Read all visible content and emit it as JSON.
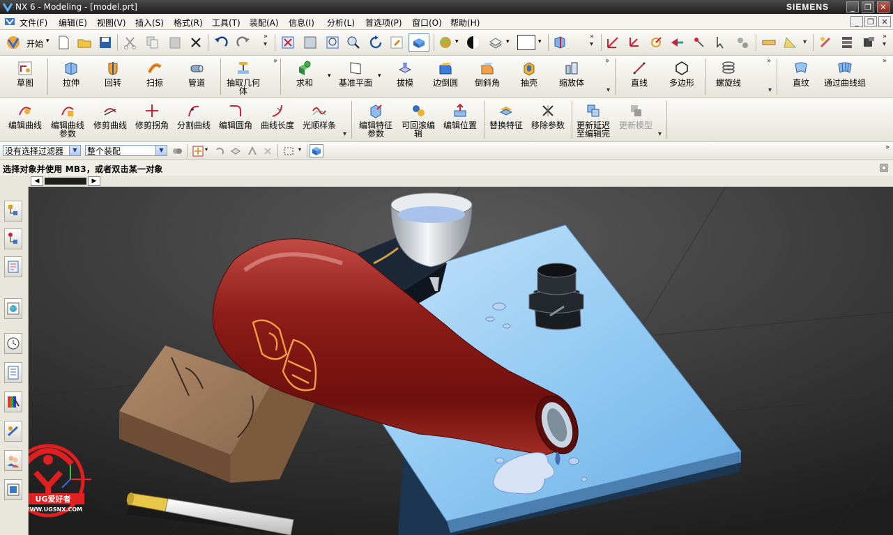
{
  "window": {
    "title": "NX 6 - Modeling - [model.prt]",
    "brand": "SIEMENS"
  },
  "menu": {
    "items": [
      "文件(F)",
      "编辑(E)",
      "视图(V)",
      "插入(S)",
      "格式(R)",
      "工具(T)",
      "装配(A)",
      "信息(I)",
      "分析(L)",
      "首选项(P)",
      "窗口(O)",
      "帮助(H)"
    ]
  },
  "toolbar1": {
    "start_label": "开始"
  },
  "toolbar2": {
    "items": [
      "草图",
      "拉伸",
      "回转",
      "扫掠",
      "管道",
      "抽取几何体",
      "求和",
      "基准平面",
      "拔模",
      "边倒圆",
      "倒斜角",
      "抽壳",
      "缩放体",
      "直线",
      "多边形",
      "螺旋线",
      "直纹",
      "通过曲线组"
    ]
  },
  "toolbar3": {
    "items": [
      "编辑曲线",
      "编辑曲线参数",
      "修剪曲线",
      "修剪拐角",
      "分割曲线",
      "编辑圆角",
      "曲线长度",
      "光顺样条",
      "编辑特征参数",
      "可回滚编辑",
      "编辑位置",
      "替换特征",
      "移除参数",
      "更新延迟至编辑完",
      "更新模型"
    ]
  },
  "filter": {
    "selection_filter": "没有选择过滤器",
    "assembly_scope": "整个装配"
  },
  "status": {
    "prompt": "选择对象并使用 MB3，或者双击某一对象"
  },
  "watermark": {
    "text": "UG爱好者",
    "url": "WWW.UGSNX.COM"
  },
  "colors": {
    "title_bg": "#2b2b2b",
    "toolbar_bg": "#f1efe7",
    "viewport_bg": "#3a3a3a",
    "bottle": "#8f1b17",
    "platform": "#8fc8f2"
  }
}
